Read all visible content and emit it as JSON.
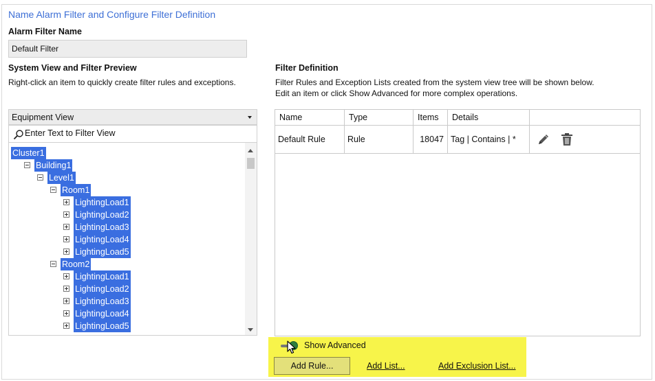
{
  "header": {
    "title": "Name Alarm Filter and Configure Filter Definition"
  },
  "filter_name": {
    "label": "Alarm Filter Name",
    "value": "Default Filter"
  },
  "preview": {
    "heading": "System View and Filter Preview",
    "hint": "Right-click an item to quickly create filter rules and exceptions.",
    "view_select": "Equipment View",
    "filter_placeholder": "Enter Text to Filter View",
    "tree": [
      {
        "label": "Cluster1",
        "level": 0,
        "expander": "none"
      },
      {
        "label": "Building1",
        "level": 1,
        "expander": "minus"
      },
      {
        "label": "Level1",
        "level": 2,
        "expander": "minus"
      },
      {
        "label": "Room1",
        "level": 3,
        "expander": "minus"
      },
      {
        "label": "LightingLoad1",
        "level": 4,
        "expander": "plus"
      },
      {
        "label": "LightingLoad2",
        "level": 4,
        "expander": "plus"
      },
      {
        "label": "LightingLoad3",
        "level": 4,
        "expander": "plus"
      },
      {
        "label": "LightingLoad4",
        "level": 4,
        "expander": "plus"
      },
      {
        "label": "LightingLoad5",
        "level": 4,
        "expander": "plus"
      },
      {
        "label": "Room2",
        "level": 3,
        "expander": "minus"
      },
      {
        "label": "LightingLoad1",
        "level": 4,
        "expander": "plus"
      },
      {
        "label": "LightingLoad2",
        "level": 4,
        "expander": "plus"
      },
      {
        "label": "LightingLoad3",
        "level": 4,
        "expander": "plus"
      },
      {
        "label": "LightingLoad4",
        "level": 4,
        "expander": "plus"
      },
      {
        "label": "LightingLoad5",
        "level": 4,
        "expander": "plus"
      }
    ]
  },
  "definition": {
    "heading": "Filter Definition",
    "hint_line1": "Filter Rules and Exception Lists created from the system view tree will be shown below.",
    "hint_line2": "Edit an item or click Show Advanced for more complex operations.",
    "columns": [
      "Name",
      "Type",
      "Items",
      "Details"
    ],
    "rows": [
      {
        "name": "Default Rule",
        "type": "Rule",
        "items": "18047",
        "details": "Tag | Contains | *",
        "actions": [
          "pencil-icon",
          "trash-icon"
        ]
      }
    ]
  },
  "actions": {
    "show_advanced": "Show Advanced",
    "add_rule": "Add Rule...",
    "add_list": "Add List...",
    "add_exclusion_list": "Add Exclusion List..."
  },
  "colors": {
    "title": "#3d6fd6",
    "tree_selection": "#3a6ee0",
    "highlight": "#f7f44a",
    "toggle_on": "#2e7d3e"
  }
}
